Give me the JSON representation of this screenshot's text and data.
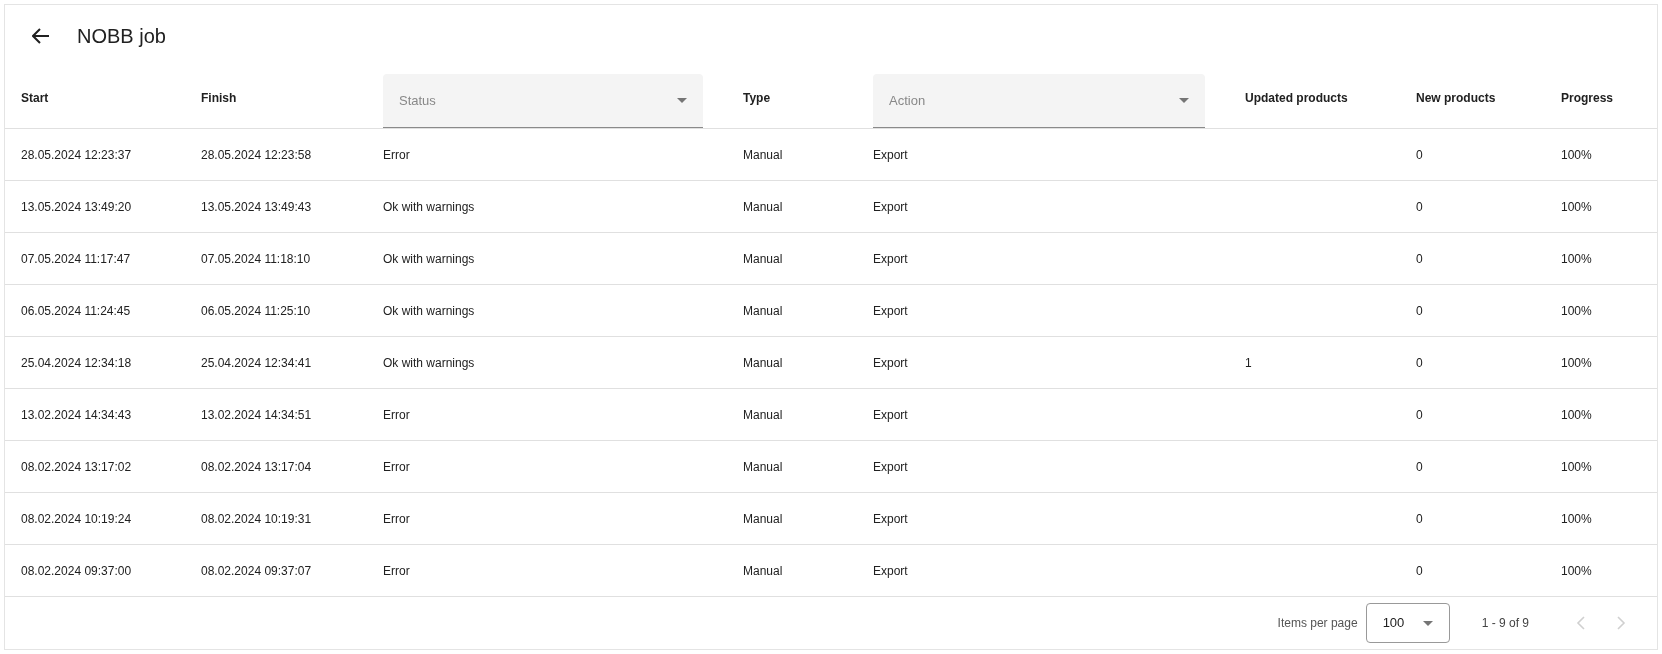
{
  "title": "NOBB job",
  "columns": [
    {
      "kind": "text",
      "label": "Start"
    },
    {
      "kind": "text",
      "label": "Finish"
    },
    {
      "kind": "filter",
      "placeholder": "Status"
    },
    {
      "kind": "text",
      "label": "Type"
    },
    {
      "kind": "filter",
      "placeholder": "Action"
    },
    {
      "kind": "text",
      "label": "Updated products"
    },
    {
      "kind": "text",
      "label": "New products"
    },
    {
      "kind": "text",
      "label": "Progress"
    }
  ],
  "rows": [
    {
      "start": "28.05.2024 12:23:37",
      "finish": "28.05.2024 12:23:58",
      "status": "Error",
      "type": "Manual",
      "action": "Export",
      "new": "0",
      "progress": "100%"
    },
    {
      "start": "13.05.2024 13:49:20",
      "finish": "13.05.2024 13:49:43",
      "status": "Ok with warnings",
      "type": "Manual",
      "action": "Export",
      "new": "0",
      "progress": "100%"
    },
    {
      "start": "07.05.2024 11:17:47",
      "finish": "07.05.2024 11:18:10",
      "status": "Ok with warnings",
      "type": "Manual",
      "action": "Export",
      "new": "0",
      "progress": "100%"
    },
    {
      "start": "06.05.2024 11:24:45",
      "finish": "06.05.2024 11:25:10",
      "status": "Ok with warnings",
      "type": "Manual",
      "action": "Export",
      "new": "0",
      "progress": "100%"
    },
    {
      "start": "25.04.2024 12:34:18",
      "finish": "25.04.2024 12:34:41",
      "status": "Ok with warnings",
      "type": "Manual",
      "action": "Export",
      "updated": "1",
      "new": "0",
      "progress": "100%"
    },
    {
      "start": "13.02.2024 14:34:43",
      "finish": "13.02.2024 14:34:51",
      "status": "Error",
      "type": "Manual",
      "action": "Export",
      "new": "0",
      "progress": "100%"
    },
    {
      "start": "08.02.2024 13:17:02",
      "finish": "08.02.2024 13:17:04",
      "status": "Error",
      "type": "Manual",
      "action": "Export",
      "new": "0",
      "progress": "100%"
    },
    {
      "start": "08.02.2024 10:19:24",
      "finish": "08.02.2024 10:19:31",
      "status": "Error",
      "type": "Manual",
      "action": "Export",
      "new": "0",
      "progress": "100%"
    },
    {
      "start": "08.02.2024 09:37:00",
      "finish": "08.02.2024 09:37:07",
      "status": "Error",
      "type": "Manual",
      "action": "Export",
      "new": "0",
      "progress": "100%"
    }
  ],
  "paginator": {
    "items_per_page_label": "Items per page",
    "page_size": "100",
    "range": "1 - 9 of 9",
    "previous_disabled": true,
    "next_disabled": true
  }
}
